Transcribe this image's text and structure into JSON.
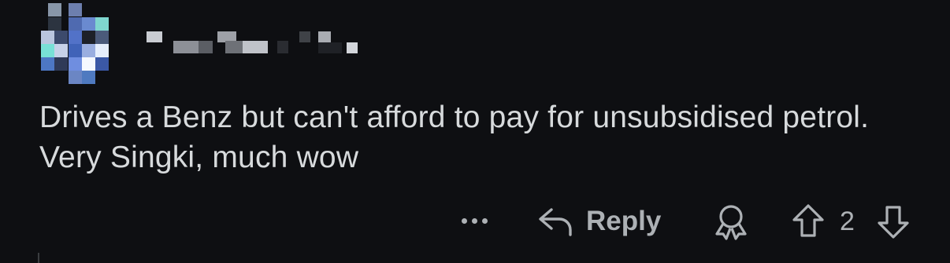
{
  "comment": {
    "username": "",
    "body": "Drives a Benz but can't afford to pay for unsubsidised petrol. Very Singki, much wow",
    "vote_count": "2"
  },
  "actions": {
    "more": "more-options",
    "reply_label": "Reply",
    "award": "award-icon",
    "upvote": "upvote-arrow-icon",
    "downvote": "downvote-arrow-icon"
  },
  "colors": {
    "background": "#0e0f12",
    "text": "#d7dadc",
    "icon": "#adb1b5"
  }
}
